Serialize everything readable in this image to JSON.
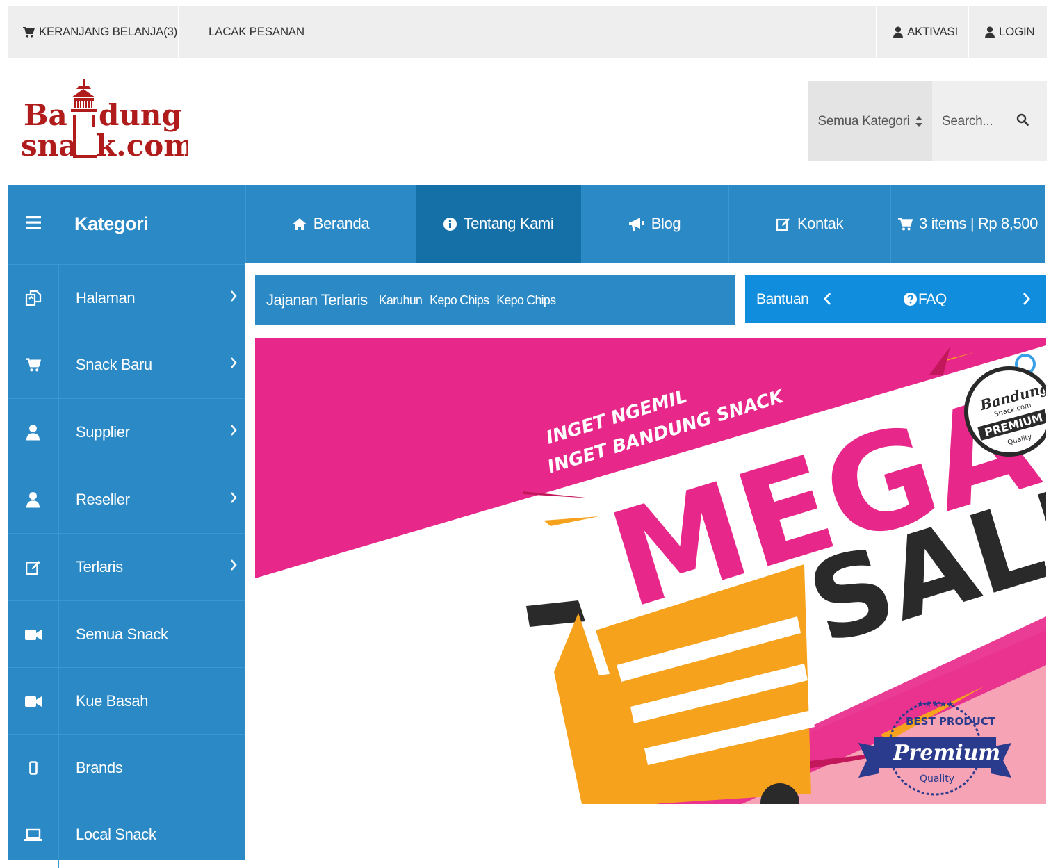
{
  "topbar": {
    "cart_label": "KERANJANG BELANJA(3)",
    "track_label": "LACAK PESANAN",
    "activation_label": "AKTIVASI",
    "login_label": "LOGIN"
  },
  "logo": {
    "line1_a": "Ba",
    "line1_b": "dung",
    "line2_a": "sna",
    "line2_b": "k.com",
    "color": "#b01c1c"
  },
  "search": {
    "category_label": "Semua Kategori",
    "placeholder": "Search..."
  },
  "nav": {
    "category_title": "Kategori",
    "items": [
      {
        "label": "Beranda",
        "icon": "home-icon"
      },
      {
        "label": "Tentang Kami",
        "icon": "info-icon",
        "active": true
      },
      {
        "label": "Blog",
        "icon": "bullhorn-icon"
      },
      {
        "label": "Kontak",
        "icon": "edit-icon"
      },
      {
        "label": "3 items | Rp 8,500",
        "icon": "cart-icon"
      }
    ]
  },
  "sidebar": {
    "items": [
      {
        "label": "Halaman",
        "icon": "copy-icon"
      },
      {
        "label": "Snack Baru",
        "icon": "cart-icon"
      },
      {
        "label": "Supplier",
        "icon": "user-icon"
      },
      {
        "label": "Reseller",
        "icon": "user-icon"
      },
      {
        "label": "Terlaris",
        "icon": "edit-icon"
      },
      {
        "label": "Semua Snack",
        "icon": "video-camera-icon"
      },
      {
        "label": "Kue Basah",
        "icon": "video-camera-icon"
      },
      {
        "label": "Brands",
        "icon": "mobile-icon"
      },
      {
        "label": "Local Snack",
        "icon": "laptop-icon"
      }
    ]
  },
  "ticker": {
    "title": "Jajanan Terlaris",
    "links": [
      "Karuhun",
      "Kepo Chips",
      "Kepo Chips"
    ]
  },
  "help": {
    "label": "Bantuan",
    "faq_label": "FAQ"
  },
  "banner": {
    "tagline1": "INGET NGEMIL",
    "tagline2": "INGET BANDUNG SNACK",
    "word1": "MEGA",
    "word2": "SALE",
    "seal_line1": "Bandung",
    "seal_line2": "Snack.com",
    "seal_line3": "PREMIUM",
    "seal_line4": "Quality",
    "badge_stars": "★★★★★",
    "badge_top": "BEST PRODUCT",
    "badge_ribbon": "Premium",
    "badge_bottom": "Quality",
    "colors": {
      "pink": "#e8278a",
      "light_pink": "#f6a3b5",
      "orange": "#f6a21d",
      "dark": "#2a2a2a",
      "navy": "#2a3a8c"
    }
  },
  "colors": {
    "nav_blue": "#2b8ac6",
    "nav_active": "#1670a8",
    "help_blue": "#118dde",
    "topbar_bg": "#eeeeee"
  }
}
